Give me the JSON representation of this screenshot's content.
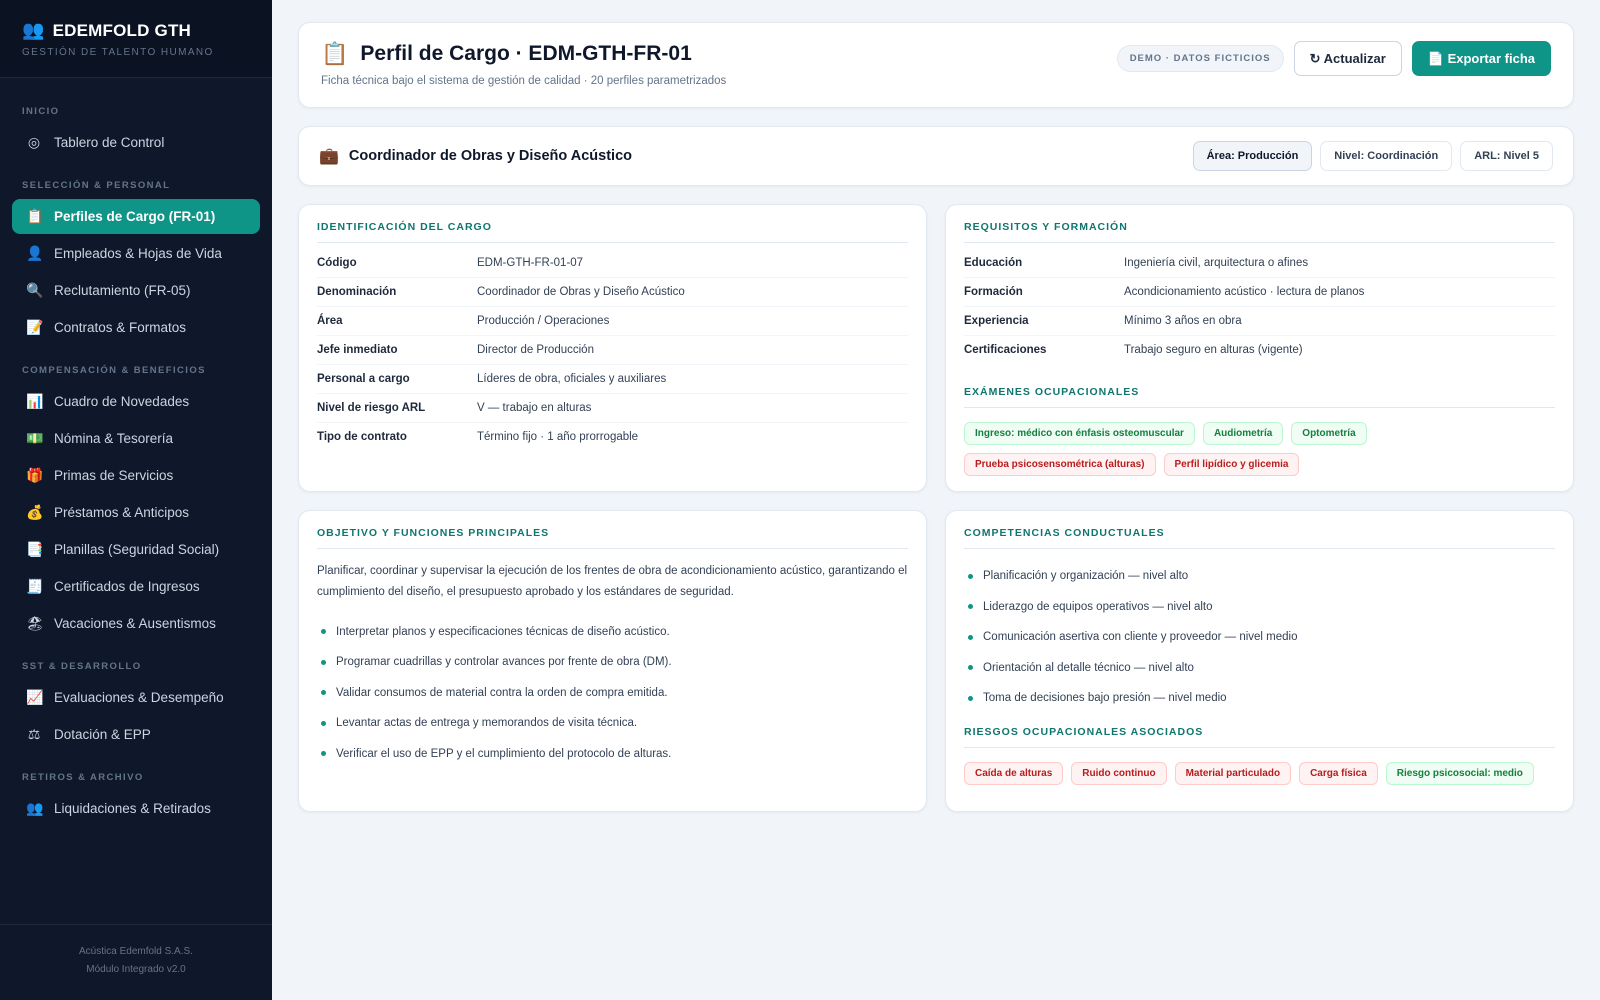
{
  "brand": {
    "title": "EDEMFOLD GTH",
    "subtitle": "GESTIÓN DE TALENTO HUMANO",
    "icon": "people-icon"
  },
  "nav": {
    "sections": [
      {
        "label": "INICIO",
        "items": [
          {
            "label": "Tablero de Control",
            "icon": "◎"
          }
        ]
      },
      {
        "label": "SELECCIÓN & PERSONAL",
        "items": [
          {
            "label": "Perfiles de Cargo (FR-01)",
            "icon": "📋",
            "active": true
          },
          {
            "label": "Empleados & Hojas de Vida",
            "icon": "👤"
          },
          {
            "label": "Reclutamiento (FR-05)",
            "icon": "🔍"
          },
          {
            "label": "Contratos & Formatos",
            "icon": "📝"
          }
        ]
      },
      {
        "label": "COMPENSACIÓN & BENEFICIOS",
        "items": [
          {
            "label": "Cuadro de Novedades",
            "icon": "📊"
          },
          {
            "label": "Nómina & Tesorería",
            "icon": "💵"
          },
          {
            "label": "Primas de Servicios",
            "icon": "🎁"
          },
          {
            "label": "Préstamos & Anticipos",
            "icon": "💰"
          },
          {
            "label": "Planillas (Seguridad Social)",
            "icon": "📑"
          },
          {
            "label": "Certificados de Ingresos",
            "icon": "🧾"
          },
          {
            "label": "Vacaciones & Ausentismos",
            "icon": "🏖"
          }
        ]
      },
      {
        "label": "SST & DESARROLLO",
        "items": [
          {
            "label": "Evaluaciones & Desempeño",
            "icon": "📈"
          },
          {
            "label": "Dotación & EPP",
            "icon": "⚖"
          }
        ]
      },
      {
        "label": "RETIROS & ARCHIVO",
        "items": [
          {
            "label": "Liquidaciones & Retirados",
            "icon": "👥"
          }
        ]
      }
    ]
  },
  "footer": {
    "company": "Acústica Edemfold S.A.S.",
    "version": "Módulo Integrado v2.0"
  },
  "header": {
    "icon": "📋",
    "title": "Perfil de Cargo · EDM-GTH-FR-01",
    "subtitle": "Ficha técnica bajo el sistema de gestión de calidad · 20 perfiles parametrizados",
    "badge": "DEMO · DATOS FICTICIOS",
    "refresh_label": "↻ Actualizar",
    "export_label": "📄 Exportar ficha"
  },
  "role": {
    "icon": "💼",
    "title": "Coordinador de Obras y Diseño Acústico",
    "chips": [
      "Área: Producción",
      "Nivel: Coordinación",
      "ARL: Nivel 5"
    ]
  },
  "identificacion": {
    "title": "IDENTIFICACIÓN DEL CARGO",
    "rows": [
      {
        "k": "Código",
        "v": "EDM-GTH-FR-01-07"
      },
      {
        "k": "Denominación",
        "v": "Coordinador de Obras y Diseño Acústico"
      },
      {
        "k": "Área",
        "v": "Producción / Operaciones"
      },
      {
        "k": "Jefe inmediato",
        "v": "Director de Producción"
      },
      {
        "k": "Personal a cargo",
        "v": "Líderes de obra, oficiales y auxiliares"
      },
      {
        "k": "Nivel de riesgo ARL",
        "v": "V — trabajo en alturas"
      },
      {
        "k": "Tipo de contrato",
        "v": "Término fijo · 1 año prorrogable"
      }
    ]
  },
  "requisitos": {
    "title": "REQUISITOS Y FORMACIÓN",
    "rows": [
      {
        "k": "Educación",
        "v": "Ingeniería civil, arquitectura o afines"
      },
      {
        "k": "Formación",
        "v": "Acondicionamiento acústico · lectura de planos"
      },
      {
        "k": "Experiencia",
        "v": "Mínimo 3 años en obra"
      },
      {
        "k": "Certificaciones",
        "v": "Trabajo seguro en alturas (vigente)"
      }
    ],
    "exams_title": "EXÁMENES OCUPACIONALES",
    "exams": [
      {
        "label": "Ingreso: médico con énfasis osteomuscular",
        "tone": "green"
      },
      {
        "label": "Audiometría",
        "tone": "green"
      },
      {
        "label": "Optometría",
        "tone": "green"
      },
      {
        "label": "Prueba psicosensométrica (alturas)",
        "tone": "red"
      },
      {
        "label": "Perfil lipídico y glicemia",
        "tone": "red"
      }
    ]
  },
  "objetivo": {
    "title": "OBJETIVO Y FUNCIONES PRINCIPALES",
    "text": "Planificar, coordinar y supervisar la ejecución de los frentes de obra de acondicionamiento acústico, garantizando el cumplimiento del diseño, el presupuesto aprobado y los estándares de seguridad.",
    "functions": [
      "Interpretar planos y especificaciones técnicas de diseño acústico.",
      "Programar cuadrillas y controlar avances por frente de obra (DM).",
      "Validar consumos de material contra la orden de compra emitida.",
      "Levantar actas de entrega y memorandos de visita técnica.",
      "Verificar el uso de EPP y el cumplimiento del protocolo de alturas."
    ]
  },
  "competencias": {
    "title": "COMPETENCIAS CONDUCTUALES",
    "items": [
      "Planificación y organización — nivel alto",
      "Liderazgo de equipos operativos — nivel alto",
      "Comunicación asertiva con cliente y proveedor — nivel medio",
      "Orientación al detalle técnico — nivel alto",
      "Toma de decisiones bajo presión — nivel medio"
    ],
    "risks_title": "RIESGOS OCUPACIONALES ASOCIADOS",
    "risks": [
      {
        "label": "Caída de alturas",
        "tone": "red"
      },
      {
        "label": "Ruido continuo",
        "tone": "red"
      },
      {
        "label": "Material particulado",
        "tone": "red"
      },
      {
        "label": "Carga física",
        "tone": "red"
      },
      {
        "label": "Riesgo psicosocial: medio",
        "tone": "green"
      }
    ]
  },
  "colors": {
    "accent": "#0f9488",
    "sidebar": "#0f172a",
    "heading": "#0f766e"
  }
}
